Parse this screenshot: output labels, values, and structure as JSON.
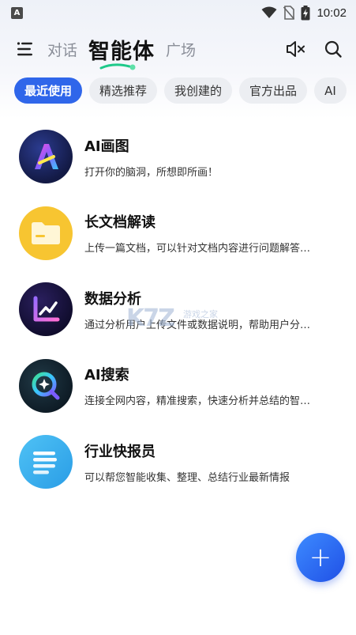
{
  "status_bar": {
    "time": "10:02",
    "icons": [
      "app-icon",
      "wifi-icon",
      "no-sim-icon",
      "battery-charging-icon"
    ]
  },
  "header": {
    "tabs": [
      {
        "label": "对话",
        "active": false
      },
      {
        "label": "智能体",
        "active": true
      },
      {
        "label": "广场",
        "active": false
      }
    ],
    "icons": [
      "menu-icon",
      "mute-icon",
      "search-icon"
    ]
  },
  "chips": [
    {
      "label": "最近使用",
      "active": true
    },
    {
      "label": "精选推荐",
      "active": false
    },
    {
      "label": "我创建的",
      "active": false
    },
    {
      "label": "官方出品",
      "active": false
    },
    {
      "label": "AI",
      "active": false
    }
  ],
  "agents": [
    {
      "title": "AI画图",
      "desc": "打开你的脑洞，所想即所画！",
      "icon": "ai-paint-icon"
    },
    {
      "title": "长文档解读",
      "desc": "上传一篇文档，可以针对文档内容进行问题解答…",
      "icon": "folder-icon"
    },
    {
      "title": "数据分析",
      "desc": "通过分析用户上传文件或数据说明，帮助用户分…",
      "icon": "chart-icon"
    },
    {
      "title": "AI搜索",
      "desc": "连接全网内容，精准搜索，快速分析并总结的智…",
      "icon": "search-q-icon"
    },
    {
      "title": "行业快报员",
      "desc": "可以帮您智能收集、整理、总结行业最新情报",
      "icon": "news-lines-icon"
    }
  ],
  "watermark": {
    "logo": "K7Z",
    "text": "游戏之家"
  },
  "fab": {
    "label": "+"
  },
  "colors": {
    "accent": "#2f66ea",
    "chip_bg": "#eceef2",
    "tab_inactive": "#8b8f99"
  }
}
